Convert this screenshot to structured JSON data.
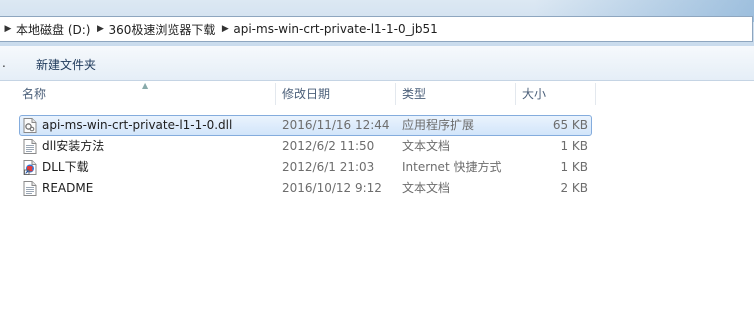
{
  "breadcrumb": {
    "items": [
      {
        "label": "本地磁盘 (D:)"
      },
      {
        "label": "360极速浏览器下载"
      },
      {
        "label": "api-ms-win-crt-private-l1-1-0_jb51"
      }
    ]
  },
  "toolbar": {
    "left_glyph": ".",
    "new_folder_label": "新建文件夹"
  },
  "columns": {
    "name": "名称",
    "date": "修改日期",
    "type": "类型",
    "size": "大小"
  },
  "files": [
    {
      "name": "api-ms-win-crt-private-l1-1-0.dll",
      "date": "2016/11/16 12:44",
      "type": "应用程序扩展",
      "size": "65 KB",
      "icon": "dll-file-icon",
      "selected": true
    },
    {
      "name": "dll安装方法",
      "date": "2012/6/2 11:50",
      "type": "文本文档",
      "size": "1 KB",
      "icon": "text-file-icon",
      "selected": false
    },
    {
      "name": "DLL下载",
      "date": "2012/6/1 21:03",
      "type": "Internet 快捷方式",
      "size": "1 KB",
      "icon": "internet-shortcut-icon",
      "selected": false
    },
    {
      "name": "README",
      "date": "2016/10/12 9:12",
      "type": "文本文档",
      "size": "2 KB",
      "icon": "text-file-icon",
      "selected": false
    }
  ],
  "colors": {
    "selection_border": "#84acdd",
    "selection_fill": "#d2e5fa",
    "header_text": "#4c607a"
  }
}
